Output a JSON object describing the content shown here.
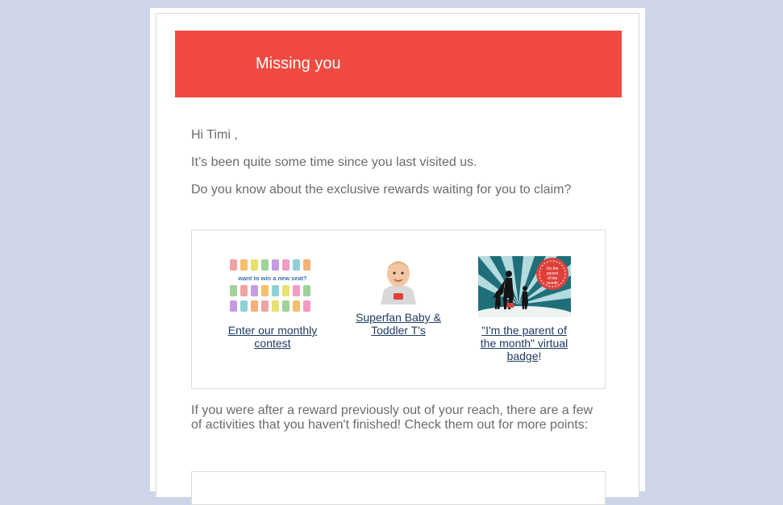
{
  "banner": {
    "title": "Missing you"
  },
  "greeting": "Hi Timi ,",
  "intro": "It’s been quite some time since you last visited us.",
  "question": "Do you know about the exclusive rewards waiting for you to claim?",
  "rewards": [
    {
      "image_text": "want to win a new seat?",
      "link_line1": "Enter our monthly",
      "link_line2": "contest"
    },
    {
      "link_line1": "Superfan Baby &",
      "link_line2": "Toddler T's"
    },
    {
      "image_text": "parent of the month",
      "link_line1": "\"I'm the parent of",
      "link_line2": "the month\" virtual",
      "link_line3": "badge",
      "link_suffix": "!"
    }
  ],
  "followup_line1": "If you were after a reward previously out of your reach, there are a few",
  "followup_line2": "of activities that you haven't finished! Check them out for more points:",
  "colors": {
    "background": "#cfd5e8",
    "banner": "#f04a42",
    "link": "#1f3b63",
    "body_text": "#6b6b6b"
  }
}
